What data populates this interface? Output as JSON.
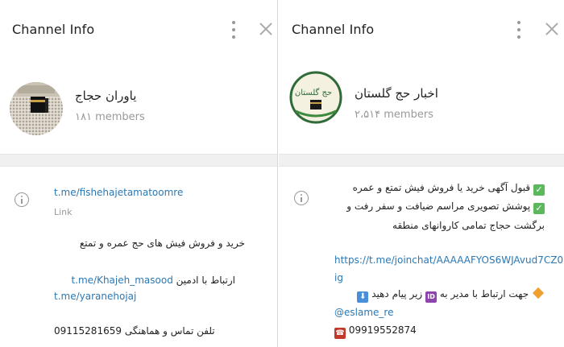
{
  "left": {
    "title": "Channel Info",
    "channel_name": "یاوران حجاج",
    "members": "۱۸۱ members",
    "link": "t.me/fishehajetamatoomre",
    "link_caption": "Link",
    "description_line1": "خرید و فروش فیش های حج عمره و تمتع",
    "contact_prefix": "ارتباط با ادمین",
    "contact_handle": "t.me/Khajeh_masood",
    "channel_link2": "t.me/yaranehojaj",
    "phone_prefix": "تلفن تماس و هماهنگی",
    "phone": "09115281659"
  },
  "right": {
    "title": "Channel Info",
    "channel_name": "اخبار حج گلستان",
    "members": "۲،۵۱۴ members",
    "description_line1": "قبول آگهی خرید یا فروش فیش تمتع و عمره",
    "description_line2": "پوشش تصویری مراسم ضیافت و سفر رفت و",
    "description_line3": "برگشت حجاج تمامی کاروانهای منطقه",
    "join_link_line1": "https://t.me/joinchat/AAAAAFYOS6WJAvud7CZ0",
    "join_link_line2": "ig",
    "contact_text_a": "جهت ارتباط با مدیر به",
    "contact_text_b": "زیر پیام دهید",
    "contact_handle": "@eslame_re",
    "phone": "09919552874",
    "avatar_text": "حج گلستان"
  },
  "icons": {
    "menu": "more-vertical-icon",
    "close": "close-icon",
    "info": "info-icon",
    "check": "check-mark-button-icon",
    "id": "id-button-icon",
    "down": "down-arrow-button-icon",
    "phone": "telephone-icon",
    "diamond": "orange-diamond-icon"
  },
  "colors": {
    "link": "#2a78b4",
    "muted": "#999999",
    "divider": "#f0f0f0"
  }
}
